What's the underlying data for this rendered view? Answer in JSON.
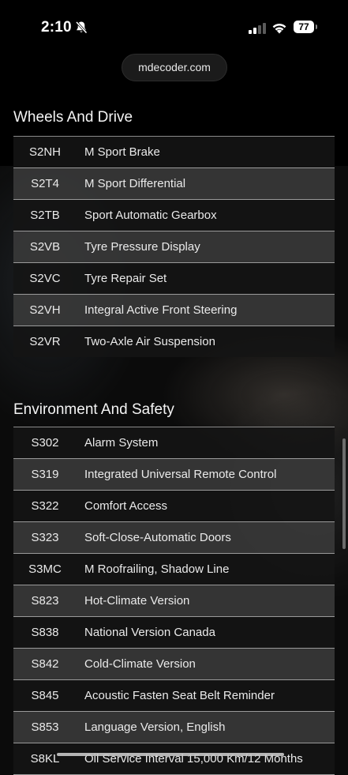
{
  "status_bar": {
    "time": "2:10",
    "battery": "77",
    "icons": [
      "bell-slash-icon",
      "signal-icon",
      "wifi-icon",
      "battery-icon"
    ]
  },
  "browser": {
    "url": "mdecoder.com"
  },
  "sections": [
    {
      "title": "Wheels And Drive",
      "rows": [
        {
          "code": "S2NH",
          "label": "M Sport Brake"
        },
        {
          "code": "S2T4",
          "label": "M Sport Differential"
        },
        {
          "code": "S2TB",
          "label": "Sport Automatic Gearbox"
        },
        {
          "code": "S2VB",
          "label": "Tyre Pressure Display"
        },
        {
          "code": "S2VC",
          "label": "Tyre Repair Set"
        },
        {
          "code": "S2VH",
          "label": "Integral Active Front Steering"
        },
        {
          "code": "S2VR",
          "label": "Two-Axle Air Suspension"
        }
      ]
    },
    {
      "title": "Environment And Safety",
      "rows": [
        {
          "code": "S302",
          "label": "Alarm System"
        },
        {
          "code": "S319",
          "label": "Integrated Universal Remote Control"
        },
        {
          "code": "S322",
          "label": "Comfort Access"
        },
        {
          "code": "S323",
          "label": "Soft-Close-Automatic Doors"
        },
        {
          "code": "S3MC",
          "label": "M Roofrailing, Shadow Line"
        },
        {
          "code": "S823",
          "label": "Hot-Climate Version"
        },
        {
          "code": "S838",
          "label": "National Version Canada"
        },
        {
          "code": "S842",
          "label": "Cold-Climate Version"
        },
        {
          "code": "S845",
          "label": "Acoustic Fasten Seat Belt Reminder"
        },
        {
          "code": "S853",
          "label": "Language Version, English"
        },
        {
          "code": "S8KL",
          "label": "Oil Service Interval 15,000 Km/12 Months"
        }
      ]
    }
  ]
}
